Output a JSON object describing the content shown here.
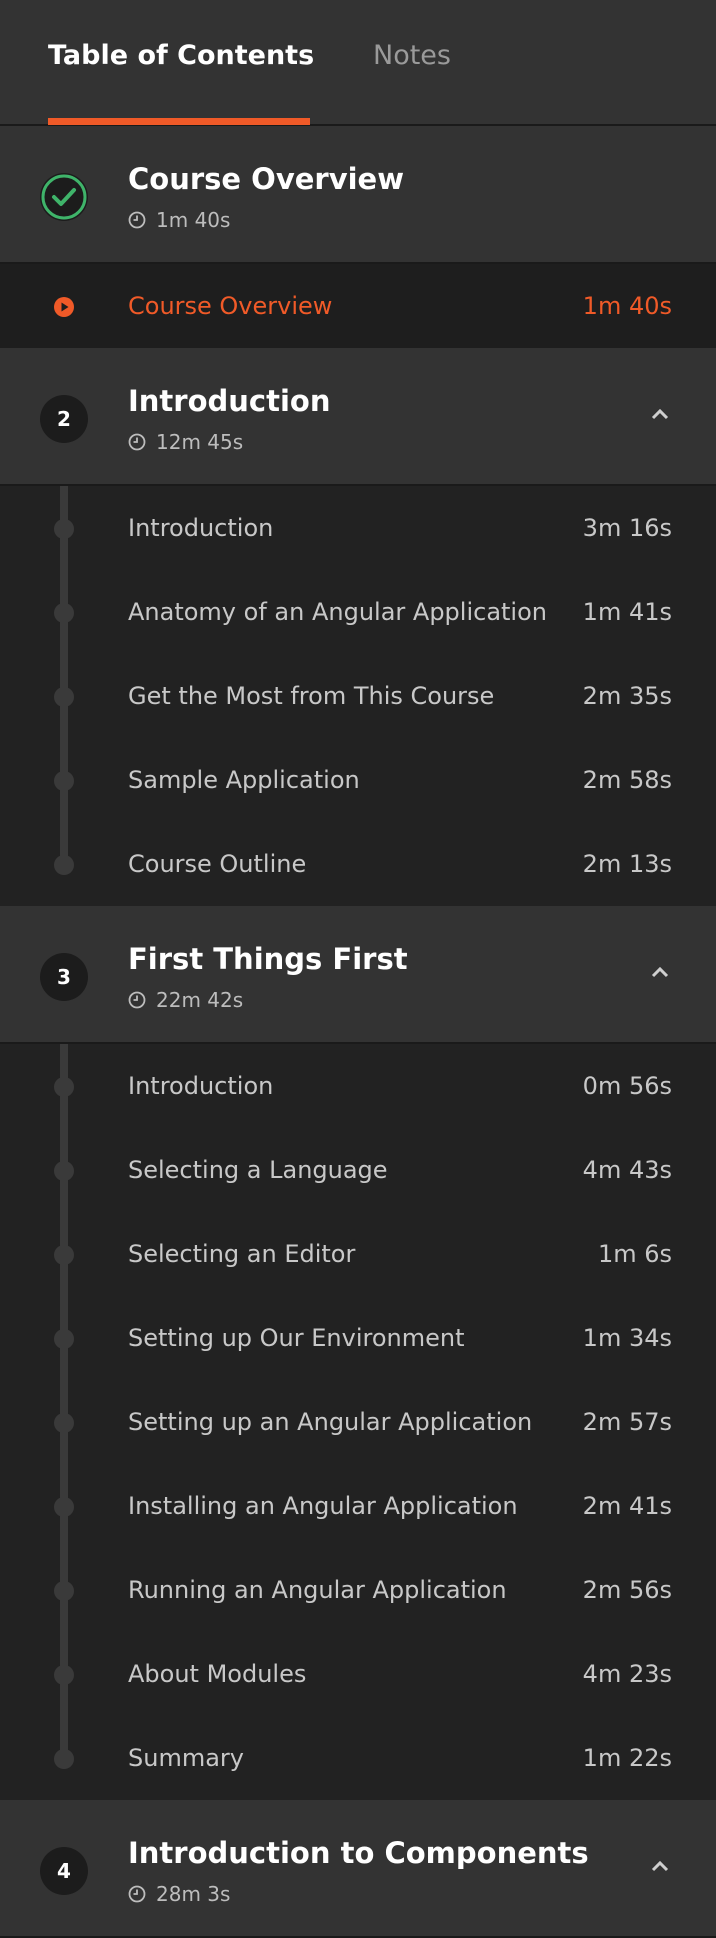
{
  "tabs": {
    "toc_label": "Table of Contents",
    "notes_label": "Notes"
  },
  "colors": {
    "accent": "#f05a28",
    "complete": "#3fb46a",
    "panel": "#333333",
    "background": "#222222"
  },
  "modules": [
    {
      "badge": "",
      "completed": true,
      "title": "Course Overview",
      "duration": "1m 40s",
      "clips": [
        {
          "title": "Course Overview",
          "time": "1m 40s",
          "current": true
        }
      ]
    },
    {
      "badge": "2",
      "title": "Introduction",
      "duration": "12m 45s",
      "clips": [
        {
          "title": "Introduction",
          "time": "3m 16s"
        },
        {
          "title": "Anatomy of an Angular Application",
          "time": "1m 41s"
        },
        {
          "title": "Get the Most from This Course",
          "time": "2m 35s"
        },
        {
          "title": "Sample Application",
          "time": "2m 58s"
        },
        {
          "title": "Course Outline",
          "time": "2m 13s"
        }
      ]
    },
    {
      "badge": "3",
      "title": "First Things First",
      "duration": "22m 42s",
      "clips": [
        {
          "title": "Introduction",
          "time": "0m 56s"
        },
        {
          "title": "Selecting a Language",
          "time": "4m 43s"
        },
        {
          "title": "Selecting an Editor",
          "time": "1m 6s"
        },
        {
          "title": "Setting up Our Environment",
          "time": "1m 34s"
        },
        {
          "title": "Setting up an Angular Application",
          "time": "2m 57s"
        },
        {
          "title": "Installing an Angular Application",
          "time": "2m 41s"
        },
        {
          "title": "Running an Angular Application",
          "time": "2m 56s"
        },
        {
          "title": "About Modules",
          "time": "4m 23s"
        },
        {
          "title": "Summary",
          "time": "1m 22s"
        }
      ]
    },
    {
      "badge": "4",
      "title": "Introduction to Components",
      "duration": "28m 3s",
      "clips": []
    }
  ]
}
